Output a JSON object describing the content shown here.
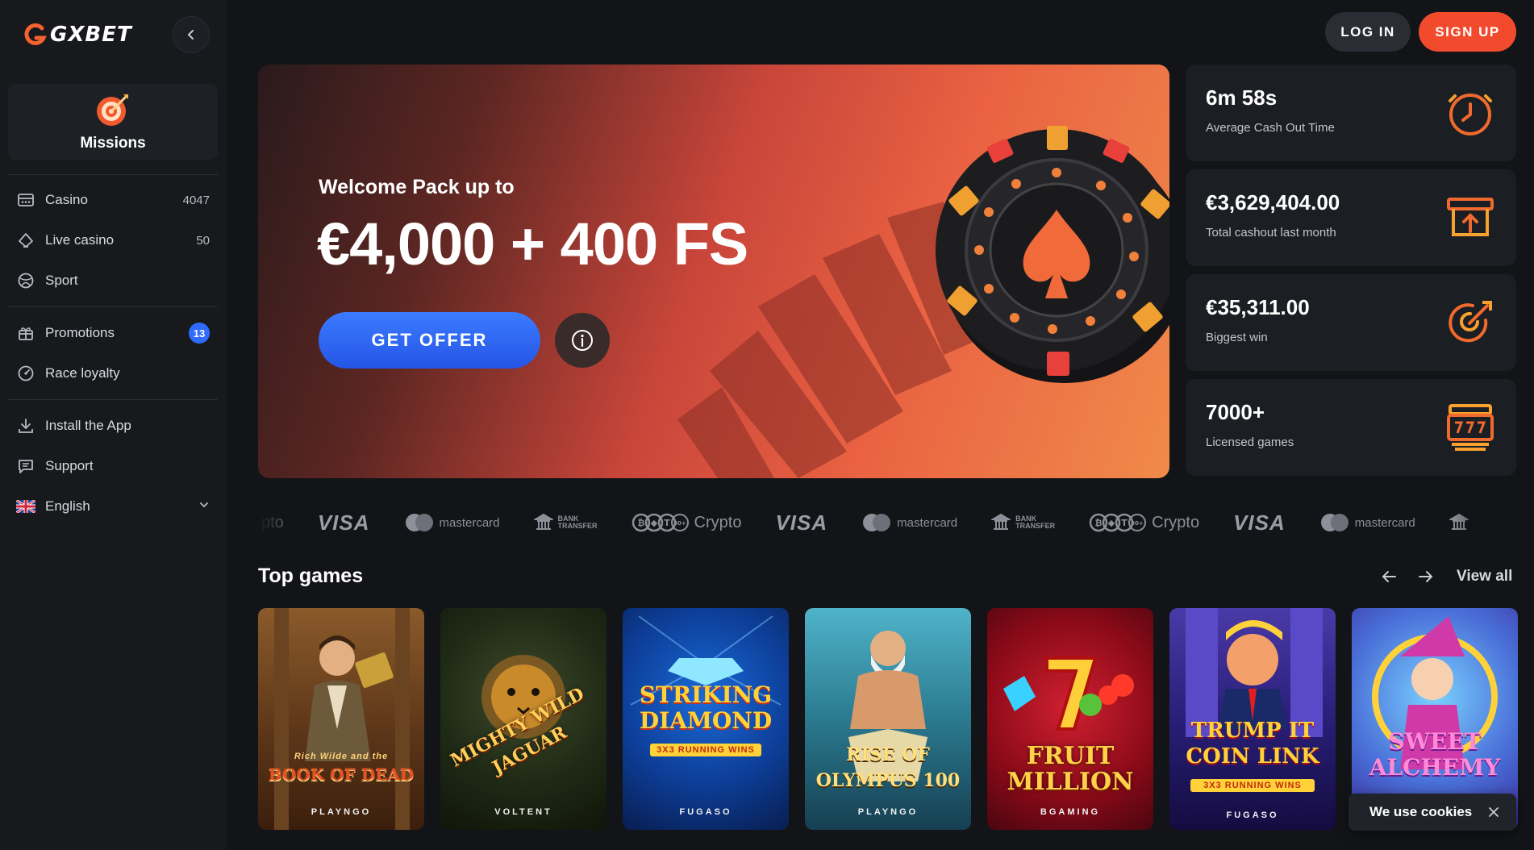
{
  "brand": {
    "name": "GXBET",
    "accent": "#f14a2c",
    "blue": "#2f6bff"
  },
  "sidebar": {
    "missions_label": "Missions",
    "nav": [
      {
        "label": "Casino",
        "count": "4047",
        "icon": "casino-icon"
      },
      {
        "label": "Live casino",
        "count": "50",
        "icon": "live-casino-icon"
      },
      {
        "label": "Sport",
        "icon": "sport-icon"
      },
      {
        "label": "Promotions",
        "badge": "13",
        "icon": "gift-icon"
      },
      {
        "label": "Race loyalty",
        "icon": "race-icon"
      },
      {
        "label": "Install the App",
        "icon": "download-icon"
      },
      {
        "label": "Support",
        "icon": "support-icon"
      },
      {
        "label": "English",
        "icon": "uk-flag-icon"
      }
    ]
  },
  "header": {
    "login_label": "LOG IN",
    "signup_label": "SIGN UP"
  },
  "hero": {
    "eyebrow": "Welcome Pack up to",
    "amount": "€4,000 + 400 FS",
    "cta_label": "GET OFFER"
  },
  "stats": [
    {
      "value": "6m 58s",
      "label": "Average Cash Out Time",
      "icon": "clock-icon"
    },
    {
      "value": "€3,629,404.00",
      "label": "Total cashout last month",
      "icon": "cashout-icon"
    },
    {
      "value": "€35,311.00",
      "label": "Biggest win",
      "icon": "target-icon"
    },
    {
      "value": "7000+",
      "label": "Licensed games",
      "icon": "slot-machine-icon"
    }
  ],
  "payments": {
    "partial_first": "pto",
    "visa": "VISA",
    "mastercard": "mastercard",
    "bank_line1": "BANK",
    "bank_line2": "TRANSFER",
    "crypto": "Crypto",
    "crypto_badge": "30+"
  },
  "top_games": {
    "title": "Top games",
    "view_all": "View all",
    "games": [
      {
        "title": "BOOK OF DEAD",
        "sub": "Rich Wilde and the",
        "provider": "PLAYNGO"
      },
      {
        "title": "MIGHTY WILD JAGUAR",
        "provider": "VOLTENT"
      },
      {
        "title": "STRIKING DIAMOND",
        "sub": "3X3 RUNNING WINS",
        "provider": "FUGASO"
      },
      {
        "title": "RISE OF OLYMPUS 100",
        "provider": "PLAYNGO"
      },
      {
        "title": "FRUIT MILLION",
        "provider": "BGAMING"
      },
      {
        "title": "TRUMP IT COIN LINK",
        "sub": "3X3 RUNNING WINS",
        "provider": "FUGASO"
      },
      {
        "title": "SWEET ALCHEMY"
      }
    ]
  },
  "cookie": {
    "text": "We use cookies"
  }
}
